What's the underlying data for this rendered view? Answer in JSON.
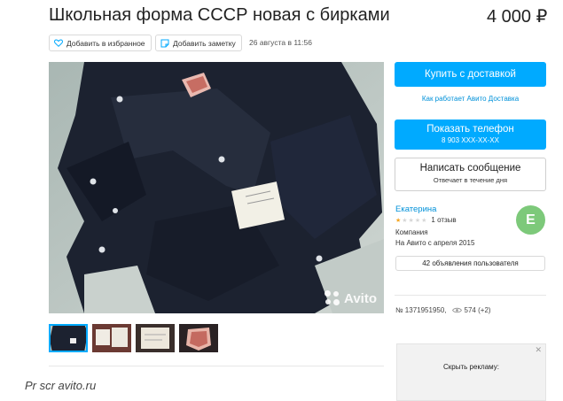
{
  "listing": {
    "title": "Школьная форма СССР новая с бирками",
    "price": "4 000 ₽",
    "favorite_label": "Добавить в избранное",
    "note_label": "Добавить заметку",
    "date": "26 августа в 11:56"
  },
  "gallery": {
    "watermark": "Avito",
    "thumbnail_count": 4,
    "selected_index": 0
  },
  "actions": {
    "buy_label": "Купить с доставкой",
    "delivery_link": "Как работает Авито Доставка",
    "phone_label": "Показать телефон",
    "phone_number": "8 903 XXX-XX-XX",
    "message_label": "Написать сообщение",
    "message_sub": "Отвечает в течение дня"
  },
  "seller": {
    "name": "Екатерина",
    "rating_stars": 1,
    "rating_max": 5,
    "reviews": "1 отзыв",
    "type": "Компания",
    "since": "На Авито с апреля 2015",
    "ads_button": "42 объявления пользователя",
    "avatar_letter": "Е"
  },
  "meta": {
    "ad_number": "№ 1371951950,",
    "views": "574 (+2)"
  },
  "ad_block": {
    "hide_label": "Скрыть рекламу:",
    "close_glyph": "✕"
  },
  "caption": "Pr scr avito.ru",
  "colors": {
    "accent": "#00aaff",
    "link": "#0091d9",
    "avatar": "#7dc97a",
    "star": "#f5a623"
  }
}
